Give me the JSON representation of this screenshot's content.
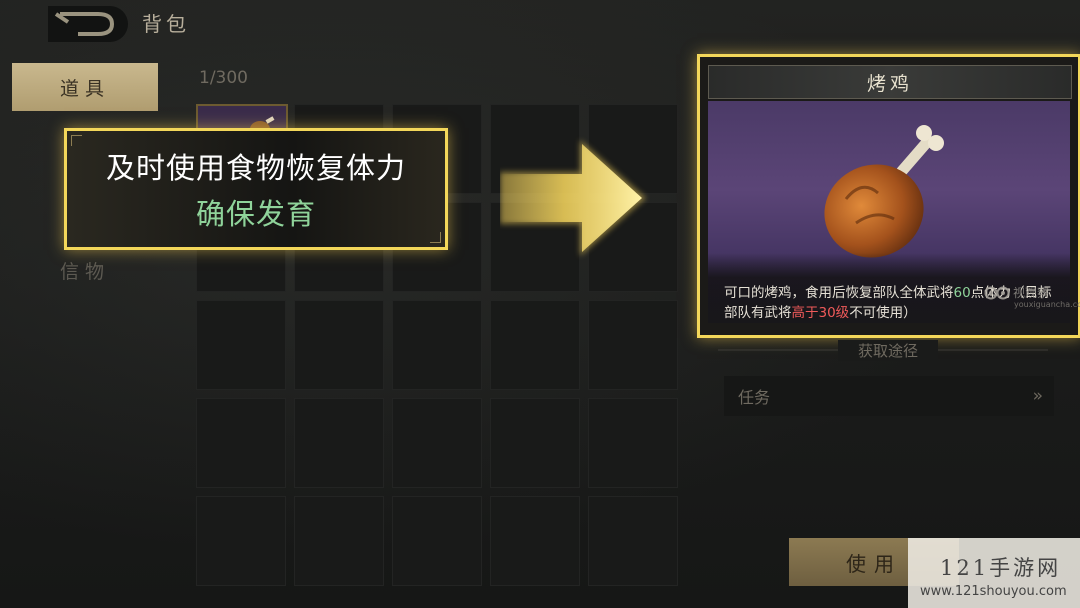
{
  "header": {
    "title": "背包"
  },
  "tabs": [
    {
      "label": "道具",
      "active": true
    },
    {
      "label": "信物",
      "active": false
    }
  ],
  "inventory": {
    "capacity": "1/300"
  },
  "callout": {
    "line1": "及时使用食物恢复体力",
    "line2": "确保发育",
    "highlight_color": "#f3d75a",
    "line2_color": "#8fd39a"
  },
  "item": {
    "name": "烤鸡",
    "desc_part1": "可口的烤鸡，食用后恢复部队全体武将",
    "desc_value": "60",
    "desc_part2": "点体力（目标部队有武将",
    "desc_condition": "高于30级",
    "desc_part3": "不可使用）",
    "image_icon": "roast-chicken-icon"
  },
  "source": {
    "title": "获取途径",
    "items": [
      {
        "label": "任务",
        "arrow": "»"
      }
    ]
  },
  "actions": {
    "use_label": "使用"
  },
  "watermarks": {
    "inline_text": "视观察",
    "inline_sub": "youxiguancha.com",
    "box_title": "121手游网",
    "box_url": "www.121shouyou.com"
  }
}
